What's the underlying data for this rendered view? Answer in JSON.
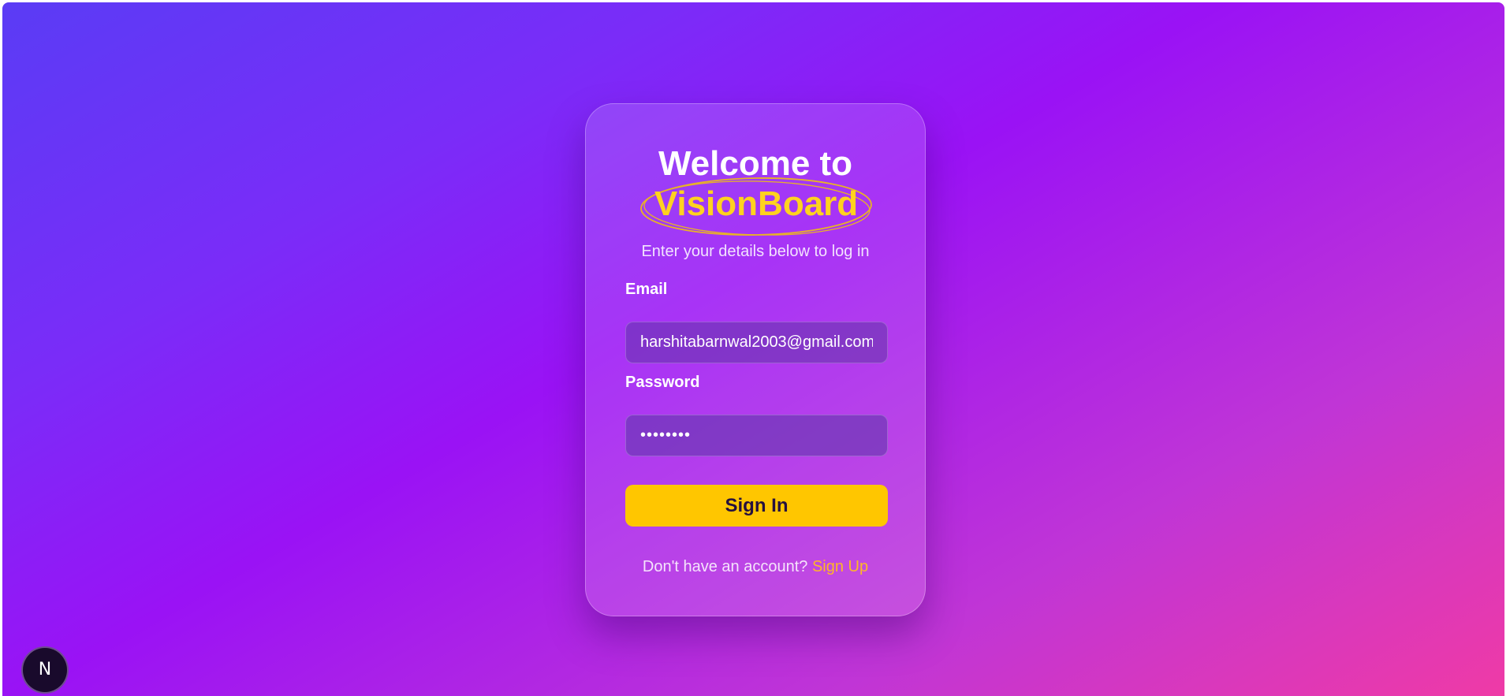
{
  "login": {
    "welcome": "Welcome to",
    "brand": "VisionBoard",
    "subtitle": "Enter your details below to log in",
    "email_label": "Email",
    "email_value": "harshitabarnwal2003@gmail.com",
    "password_label": "Password",
    "password_value": "password",
    "signin_label": "Sign In",
    "footer_text": "Don't have an account?",
    "signup_label": "Sign Up"
  },
  "badge": {
    "letter": "N",
    "icon": "nextjs-n-icon"
  },
  "colors": {
    "gradient_start": "#5a3cf5",
    "gradient_mid": "#9a12f5",
    "gradient_end": "#ef3aa6",
    "accent": "#ffd21f",
    "button": "#ffc600",
    "link": "#ffb627"
  }
}
